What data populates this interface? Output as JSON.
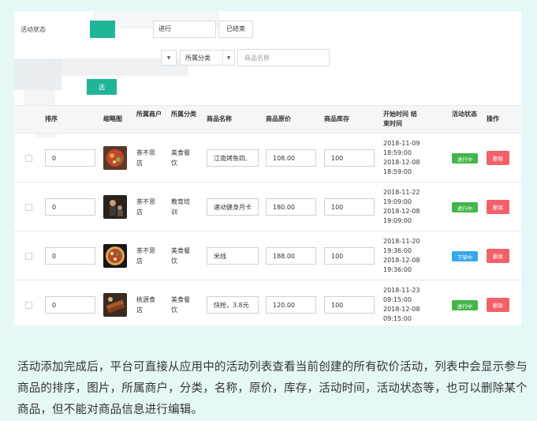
{
  "filters": {
    "status_label": "活动状态",
    "status_in_progress": "进行",
    "status_ended": "已结束",
    "category_select": "所属分类",
    "product_name_placeholder": "商品名称",
    "delete_selected": "选"
  },
  "table": {
    "headers": {
      "sort": "排序",
      "thumbnail": "缩略图",
      "merchant": "所属商户",
      "category": "所属分类",
      "product_name": "商品名称",
      "original_price": "商品原价",
      "stock": "商品库存",
      "time": "开始时间 结束时间",
      "status": "活动状态",
      "action": "操作"
    },
    "rows": [
      {
        "sort": "0",
        "merchant": "茶不思店",
        "category": "美食餐饮",
        "product_name": "江南烤鱼四,",
        "price": "108.00",
        "stock": "100",
        "start": "2018-11-09 18:59:00",
        "end": "2018-12-08 18:59:00",
        "status": "进行中",
        "status_color": "#43b64a",
        "action": "删除",
        "thumb_icon": "food-photo"
      },
      {
        "sort": "0",
        "merchant": "茶不思店",
        "category": "教育培训",
        "product_name": "速动健身月卡",
        "price": "180.00",
        "stock": "100",
        "start": "2018-11-22 19:09:00",
        "end": "2018-12-08 19:09:00",
        "status": "进行中",
        "status_color": "#43b64a",
        "action": "删除",
        "thumb_icon": "gym-photo"
      },
      {
        "sort": "0",
        "merchant": "茶不思店",
        "category": "美食餐饮",
        "product_name": "米线",
        "price": "188.00",
        "stock": "100",
        "start": "2018-11-20 19:36:00",
        "end": "2018-12-08 19:36:00",
        "status": "下架中",
        "status_color": "#39a8e8",
        "action": "删除",
        "thumb_icon": "pizza-photo"
      },
      {
        "sort": "0",
        "merchant": "桃源食店",
        "category": "美食餐饮",
        "product_name": "快抢，3.8元",
        "price": "120.00",
        "stock": "100",
        "start": "2018-11-23 09:15:00",
        "end": "2018-12-08 09:15:00",
        "status": "进行中",
        "status_color": "#43b64a",
        "action": "删除",
        "thumb_icon": "skewer-photo"
      }
    ]
  },
  "caption": "活动添加完成后，平台可直接从应用中的活动列表查看当前创建的所有砍价活动，列表中会显示参与商品的排序，图片，所属商户，分类，名称，原价，库存，活动时间，活动状态等，也可以删除某个商品，但不能对商品信息进行编辑。"
}
